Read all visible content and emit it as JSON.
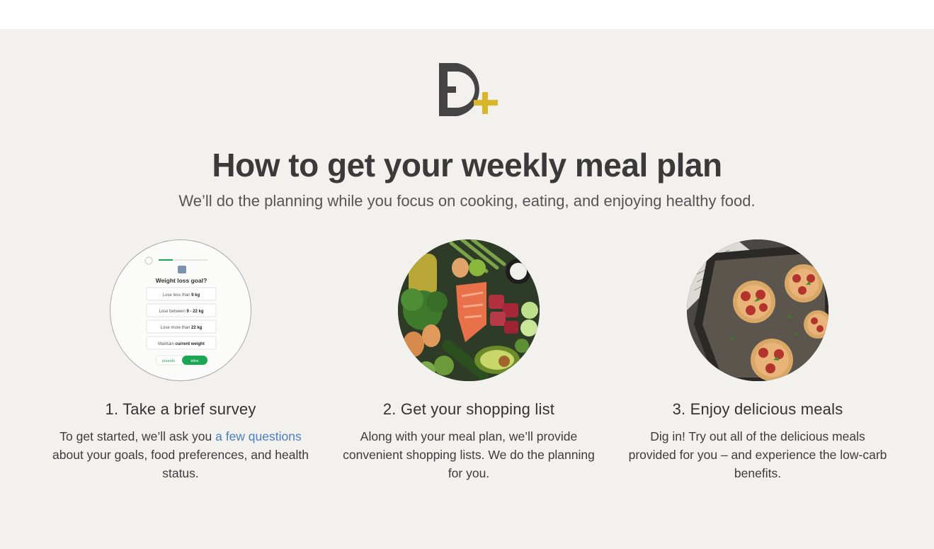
{
  "page": {
    "title": "How to get your weekly meal plan",
    "subtitle": "We’ll do the planning while you focus on cooking, eating, and enjoying healthy food."
  },
  "logo": {
    "icon": "diet-doctor-plus-logo",
    "colors": {
      "letter": "#444444",
      "plus": "#d9b52a"
    }
  },
  "colors": {
    "background": "#f2f1ee",
    "link": "#4a7fc0",
    "accent_green": "#1aa655"
  },
  "survey_mock": {
    "question": "Weight loss goal?",
    "options": [
      {
        "prefix": "Lose less than ",
        "bold": "9 kg"
      },
      {
        "prefix": "Lose between ",
        "bold": "9 - 22 kg"
      },
      {
        "prefix": "Lose more than ",
        "bold": "22 kg"
      },
      {
        "prefix": "Maintain ",
        "bold": "current weight"
      }
    ],
    "unit_toggle": {
      "left": "pounds",
      "right": "kilos",
      "selected": "kilos"
    }
  },
  "steps": [
    {
      "title": "1. Take a brief survey",
      "desc_before": "To get started, we’ll ask you ",
      "desc_link": "a few questions",
      "desc_after": " about your goals, food preferences, and health status.",
      "image": "survey-screenshot-image"
    },
    {
      "title": "2. Get your shopping list",
      "desc": "Along with your meal plan, we’ll provide convenient shopping lists. We do the planning for you.",
      "image": "groceries-image"
    },
    {
      "title": "3. Enjoy delicious meals",
      "desc": "Dig in! Try out all of the delicious meals provided for you – and experience the low-carb benefits.",
      "image": "pizzas-image"
    }
  ]
}
